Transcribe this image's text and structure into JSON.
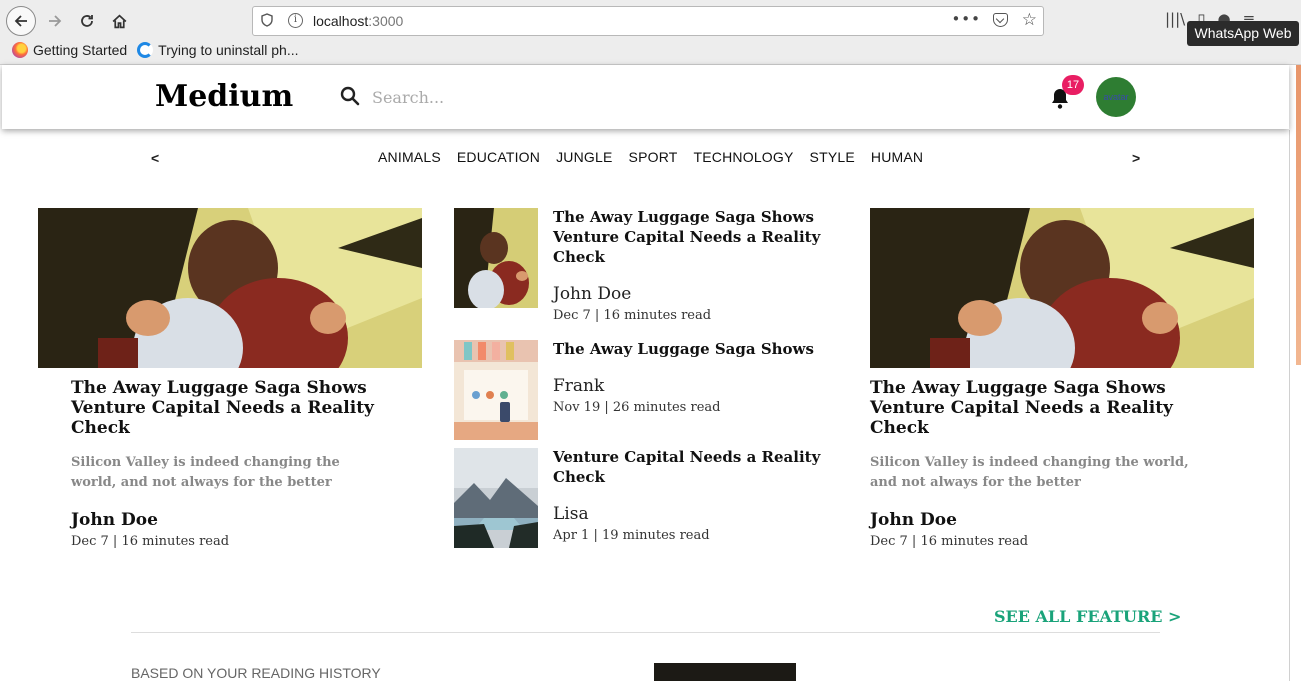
{
  "browser": {
    "url_host": "localhost",
    "url_port": ":3000",
    "bookmarks": [
      {
        "label": "Getting Started"
      },
      {
        "label": "Trying to uninstall ph..."
      }
    ],
    "tooltip": "WhatsApp Web"
  },
  "header": {
    "logo": "Medium",
    "search_placeholder": "Search...",
    "notification_count": "17",
    "avatar_alt": "avatar"
  },
  "categories": {
    "prev": "<",
    "next": ">",
    "items": [
      "ANIMALS",
      "EDUCATION",
      "JUNGLE",
      "SPORT",
      "TECHNOLOGY",
      "STYLE",
      "HUMAN"
    ]
  },
  "featured_left": {
    "title": "The Away Luggage Saga Shows Venture Capital Needs a Reality Check",
    "subtitle": "Silicon Valley is indeed changing the world, and not always for the better",
    "author": "John Doe",
    "meta": "Dec 7 | 16 minutes read"
  },
  "featured_middle": [
    {
      "title": "The Away Luggage Saga Shows Venture Capital Needs a Reality Check",
      "author": "John Doe",
      "meta": "Dec 7 | 16 minutes read"
    },
    {
      "title": "The Away Luggage Saga Shows",
      "author": "Frank",
      "meta": "Nov 19 | 26 minutes read"
    },
    {
      "title": "Venture Capital Needs a Reality Check",
      "author": "Lisa",
      "meta": "Apr 1 | 19 minutes read"
    }
  ],
  "featured_right": {
    "title": "The Away Luggage Saga Shows Venture Capital Needs a Reality Check",
    "subtitle": "Silicon Valley is indeed changing the world, and not always for the better",
    "author": "John Doe",
    "meta": "Dec 7 | 16 minutes read"
  },
  "see_all": "SEE ALL FEATURE >",
  "history_heading": "BASED ON YOUR READING HISTORY",
  "colors": {
    "accent_green": "#1aa37a",
    "badge_pink": "#e91e63"
  }
}
